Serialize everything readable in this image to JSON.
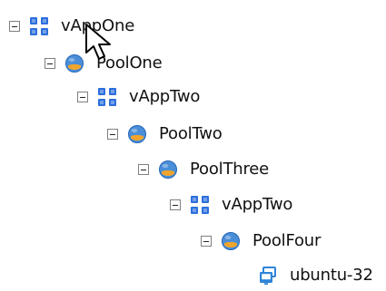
{
  "tree": {
    "items": [
      {
        "label": "vAppOne",
        "icon": "vapp-icon",
        "expanded": true
      },
      {
        "label": "PoolOne",
        "icon": "resource-pool-icon",
        "expanded": true
      },
      {
        "label": "vAppTwo",
        "icon": "vapp-icon",
        "expanded": true
      },
      {
        "label": "PoolTwo",
        "icon": "resource-pool-icon",
        "expanded": true
      },
      {
        "label": "PoolThree",
        "icon": "resource-pool-icon",
        "expanded": true
      },
      {
        "label": "vAppTwo",
        "icon": "vapp-icon",
        "expanded": true
      },
      {
        "label": "PoolFour",
        "icon": "resource-pool-icon",
        "expanded": true
      },
      {
        "label": "ubuntu-32",
        "icon": "virtual-machine-icon",
        "expanded": false
      }
    ]
  },
  "colors": {
    "text": "#111111",
    "vapp_blue": "#2c6fdc",
    "pool_blue": "#4a8ed8",
    "pool_orange": "#f0a52c",
    "vm_blue": "#2f84d8",
    "toggle_border": "#7f7f7f"
  }
}
